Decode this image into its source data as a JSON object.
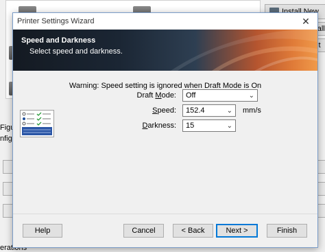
{
  "background": {
    "install_button_label": "Install New",
    "side_button_1": "Install P",
    "side_button_2": "Print",
    "left_fragment_1": "Figur",
    "left_fragment_2": "nfigu",
    "bottom_fragment": "erations"
  },
  "dialog": {
    "title": "Printer Settings Wizard",
    "banner_title": "Speed and Darkness",
    "banner_subtitle": "Select speed and darkness.",
    "warning": "Warning: Speed setting is ignored when Draft Mode is On",
    "fields": {
      "draft_mode": {
        "label_pre": "Draft ",
        "label_key": "M",
        "label_post": "ode:",
        "value": "Off"
      },
      "speed": {
        "label_pre": "",
        "label_key": "S",
        "label_post": "peed:",
        "value": "152.4",
        "unit": "mm/s"
      },
      "darkness": {
        "label_pre": "",
        "label_key": "D",
        "label_post": "arkness:",
        "value": "15"
      }
    },
    "buttons": {
      "help": "Help",
      "cancel": "Cancel",
      "back": "< Back",
      "next": "Next >",
      "finish": "Finish"
    }
  }
}
